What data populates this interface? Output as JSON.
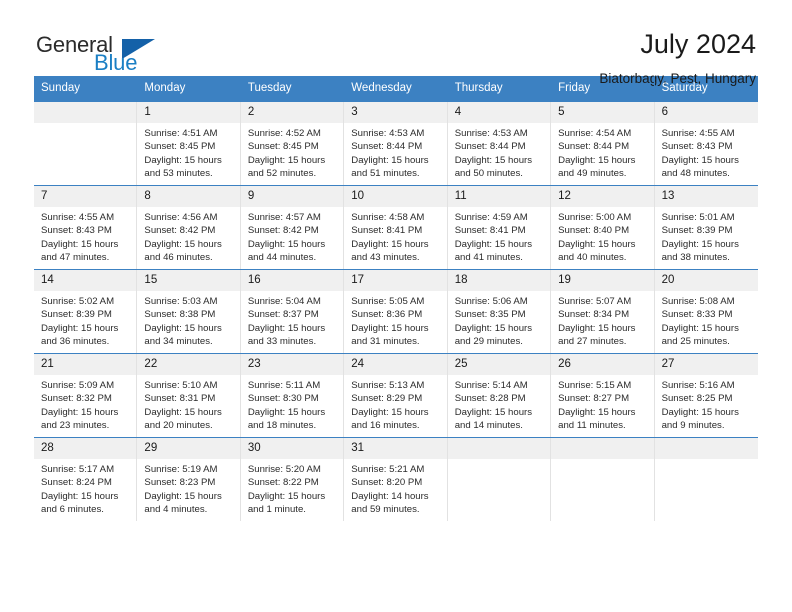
{
  "brand": {
    "name_top": "General",
    "name_bottom": "Blue",
    "triangle_color": "#1461a8",
    "blue_color": "#1b7fc4"
  },
  "header": {
    "title": "July 2024",
    "subtitle": "Biatorbagy, Pest, Hungary"
  },
  "theme": {
    "header_blue": "#3c81c2",
    "day_band_gray": "#f0f0f0",
    "grid_line": "#e2e2e2"
  },
  "weekdays": [
    "Sunday",
    "Monday",
    "Tuesday",
    "Wednesday",
    "Thursday",
    "Friday",
    "Saturday"
  ],
  "weeks": [
    [
      {
        "day": "",
        "sunrise": "",
        "sunset": "",
        "daylight_line1": "",
        "daylight_line2": ""
      },
      {
        "day": "1",
        "sunrise": "Sunrise: 4:51 AM",
        "sunset": "Sunset: 8:45 PM",
        "daylight_line1": "Daylight: 15 hours",
        "daylight_line2": "and 53 minutes."
      },
      {
        "day": "2",
        "sunrise": "Sunrise: 4:52 AM",
        "sunset": "Sunset: 8:45 PM",
        "daylight_line1": "Daylight: 15 hours",
        "daylight_line2": "and 52 minutes."
      },
      {
        "day": "3",
        "sunrise": "Sunrise: 4:53 AM",
        "sunset": "Sunset: 8:44 PM",
        "daylight_line1": "Daylight: 15 hours",
        "daylight_line2": "and 51 minutes."
      },
      {
        "day": "4",
        "sunrise": "Sunrise: 4:53 AM",
        "sunset": "Sunset: 8:44 PM",
        "daylight_line1": "Daylight: 15 hours",
        "daylight_line2": "and 50 minutes."
      },
      {
        "day": "5",
        "sunrise": "Sunrise: 4:54 AM",
        "sunset": "Sunset: 8:44 PM",
        "daylight_line1": "Daylight: 15 hours",
        "daylight_line2": "and 49 minutes."
      },
      {
        "day": "6",
        "sunrise": "Sunrise: 4:55 AM",
        "sunset": "Sunset: 8:43 PM",
        "daylight_line1": "Daylight: 15 hours",
        "daylight_line2": "and 48 minutes."
      }
    ],
    [
      {
        "day": "7",
        "sunrise": "Sunrise: 4:55 AM",
        "sunset": "Sunset: 8:43 PM",
        "daylight_line1": "Daylight: 15 hours",
        "daylight_line2": "and 47 minutes."
      },
      {
        "day": "8",
        "sunrise": "Sunrise: 4:56 AM",
        "sunset": "Sunset: 8:42 PM",
        "daylight_line1": "Daylight: 15 hours",
        "daylight_line2": "and 46 minutes."
      },
      {
        "day": "9",
        "sunrise": "Sunrise: 4:57 AM",
        "sunset": "Sunset: 8:42 PM",
        "daylight_line1": "Daylight: 15 hours",
        "daylight_line2": "and 44 minutes."
      },
      {
        "day": "10",
        "sunrise": "Sunrise: 4:58 AM",
        "sunset": "Sunset: 8:41 PM",
        "daylight_line1": "Daylight: 15 hours",
        "daylight_line2": "and 43 minutes."
      },
      {
        "day": "11",
        "sunrise": "Sunrise: 4:59 AM",
        "sunset": "Sunset: 8:41 PM",
        "daylight_line1": "Daylight: 15 hours",
        "daylight_line2": "and 41 minutes."
      },
      {
        "day": "12",
        "sunrise": "Sunrise: 5:00 AM",
        "sunset": "Sunset: 8:40 PM",
        "daylight_line1": "Daylight: 15 hours",
        "daylight_line2": "and 40 minutes."
      },
      {
        "day": "13",
        "sunrise": "Sunrise: 5:01 AM",
        "sunset": "Sunset: 8:39 PM",
        "daylight_line1": "Daylight: 15 hours",
        "daylight_line2": "and 38 minutes."
      }
    ],
    [
      {
        "day": "14",
        "sunrise": "Sunrise: 5:02 AM",
        "sunset": "Sunset: 8:39 PM",
        "daylight_line1": "Daylight: 15 hours",
        "daylight_line2": "and 36 minutes."
      },
      {
        "day": "15",
        "sunrise": "Sunrise: 5:03 AM",
        "sunset": "Sunset: 8:38 PM",
        "daylight_line1": "Daylight: 15 hours",
        "daylight_line2": "and 34 minutes."
      },
      {
        "day": "16",
        "sunrise": "Sunrise: 5:04 AM",
        "sunset": "Sunset: 8:37 PM",
        "daylight_line1": "Daylight: 15 hours",
        "daylight_line2": "and 33 minutes."
      },
      {
        "day": "17",
        "sunrise": "Sunrise: 5:05 AM",
        "sunset": "Sunset: 8:36 PM",
        "daylight_line1": "Daylight: 15 hours",
        "daylight_line2": "and 31 minutes."
      },
      {
        "day": "18",
        "sunrise": "Sunrise: 5:06 AM",
        "sunset": "Sunset: 8:35 PM",
        "daylight_line1": "Daylight: 15 hours",
        "daylight_line2": "and 29 minutes."
      },
      {
        "day": "19",
        "sunrise": "Sunrise: 5:07 AM",
        "sunset": "Sunset: 8:34 PM",
        "daylight_line1": "Daylight: 15 hours",
        "daylight_line2": "and 27 minutes."
      },
      {
        "day": "20",
        "sunrise": "Sunrise: 5:08 AM",
        "sunset": "Sunset: 8:33 PM",
        "daylight_line1": "Daylight: 15 hours",
        "daylight_line2": "and 25 minutes."
      }
    ],
    [
      {
        "day": "21",
        "sunrise": "Sunrise: 5:09 AM",
        "sunset": "Sunset: 8:32 PM",
        "daylight_line1": "Daylight: 15 hours",
        "daylight_line2": "and 23 minutes."
      },
      {
        "day": "22",
        "sunrise": "Sunrise: 5:10 AM",
        "sunset": "Sunset: 8:31 PM",
        "daylight_line1": "Daylight: 15 hours",
        "daylight_line2": "and 20 minutes."
      },
      {
        "day": "23",
        "sunrise": "Sunrise: 5:11 AM",
        "sunset": "Sunset: 8:30 PM",
        "daylight_line1": "Daylight: 15 hours",
        "daylight_line2": "and 18 minutes."
      },
      {
        "day": "24",
        "sunrise": "Sunrise: 5:13 AM",
        "sunset": "Sunset: 8:29 PM",
        "daylight_line1": "Daylight: 15 hours",
        "daylight_line2": "and 16 minutes."
      },
      {
        "day": "25",
        "sunrise": "Sunrise: 5:14 AM",
        "sunset": "Sunset: 8:28 PM",
        "daylight_line1": "Daylight: 15 hours",
        "daylight_line2": "and 14 minutes."
      },
      {
        "day": "26",
        "sunrise": "Sunrise: 5:15 AM",
        "sunset": "Sunset: 8:27 PM",
        "daylight_line1": "Daylight: 15 hours",
        "daylight_line2": "and 11 minutes."
      },
      {
        "day": "27",
        "sunrise": "Sunrise: 5:16 AM",
        "sunset": "Sunset: 8:25 PM",
        "daylight_line1": "Daylight: 15 hours",
        "daylight_line2": "and 9 minutes."
      }
    ],
    [
      {
        "day": "28",
        "sunrise": "Sunrise: 5:17 AM",
        "sunset": "Sunset: 8:24 PM",
        "daylight_line1": "Daylight: 15 hours",
        "daylight_line2": "and 6 minutes."
      },
      {
        "day": "29",
        "sunrise": "Sunrise: 5:19 AM",
        "sunset": "Sunset: 8:23 PM",
        "daylight_line1": "Daylight: 15 hours",
        "daylight_line2": "and 4 minutes."
      },
      {
        "day": "30",
        "sunrise": "Sunrise: 5:20 AM",
        "sunset": "Sunset: 8:22 PM",
        "daylight_line1": "Daylight: 15 hours",
        "daylight_line2": "and 1 minute."
      },
      {
        "day": "31",
        "sunrise": "Sunrise: 5:21 AM",
        "sunset": "Sunset: 8:20 PM",
        "daylight_line1": "Daylight: 14 hours",
        "daylight_line2": "and 59 minutes."
      },
      {
        "day": "",
        "sunrise": "",
        "sunset": "",
        "daylight_line1": "",
        "daylight_line2": ""
      },
      {
        "day": "",
        "sunrise": "",
        "sunset": "",
        "daylight_line1": "",
        "daylight_line2": ""
      },
      {
        "day": "",
        "sunrise": "",
        "sunset": "",
        "daylight_line1": "",
        "daylight_line2": ""
      }
    ]
  ]
}
